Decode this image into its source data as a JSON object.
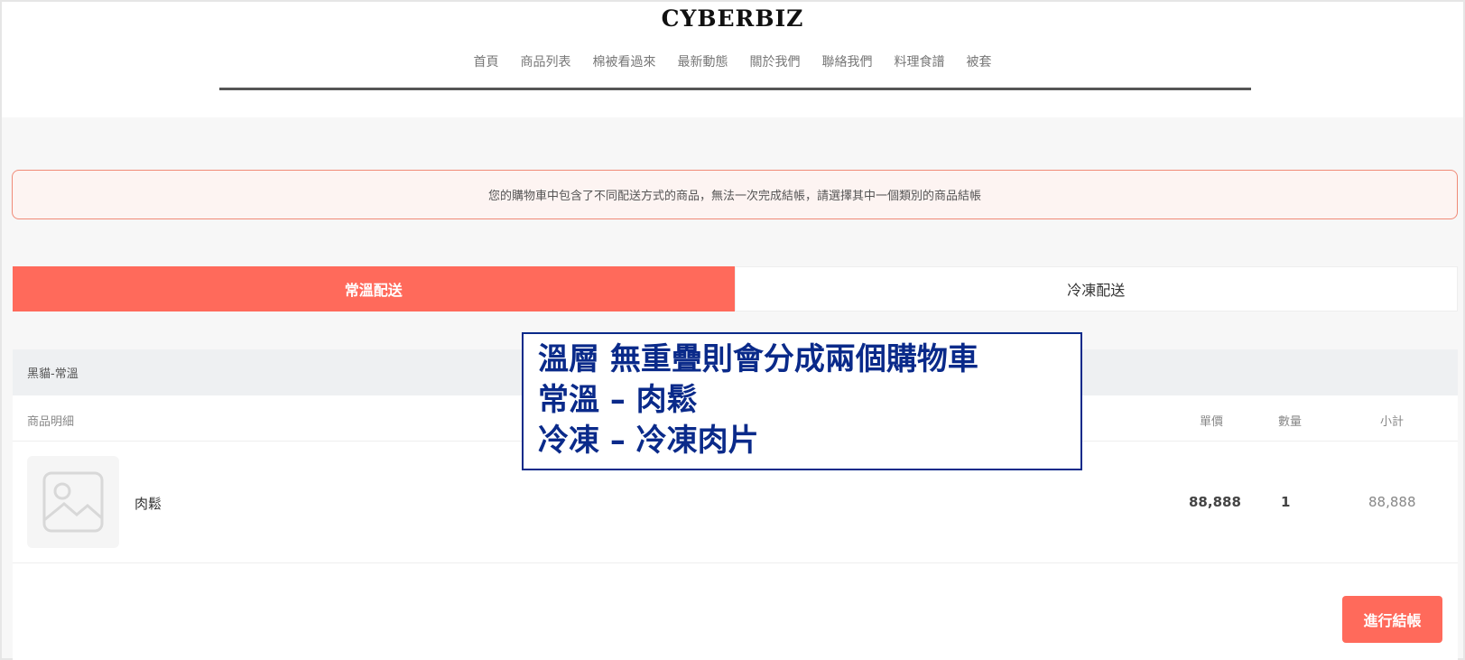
{
  "header": {
    "logo": "CYBERBIZ",
    "nav": [
      "首頁",
      "商品列表",
      "棉被看過來",
      "最新動態",
      "關於我們",
      "聯絡我們",
      "料理食譜",
      "被套"
    ]
  },
  "alert": {
    "text": "您的購物車中包含了不同配送方式的商品，無法一次完成結帳，請選擇其中一個類別的商品結帳"
  },
  "tabs": {
    "room_temp": "常溫配送",
    "frozen": "冷凍配送"
  },
  "cart": {
    "shipping_method": "黑貓-常溫",
    "columns": {
      "details": "商品明細",
      "unit_price": "單價",
      "quantity": "數量",
      "subtotal": "小計"
    },
    "items": [
      {
        "name": "肉鬆",
        "unit_price": "88,888",
        "quantity": "1",
        "subtotal": "88,888"
      }
    ],
    "checkout_label": "進行結帳"
  },
  "annotation": {
    "line1": "溫層 無重疊則會分成兩個購物車",
    "line2": "常溫 – 肉鬆",
    "line3": "冷凍 – 冷凍肉片"
  },
  "colors": {
    "accent": "#ff6a5b",
    "annotation_border": "#0a2a8a",
    "alert_border": "#f08a77"
  }
}
